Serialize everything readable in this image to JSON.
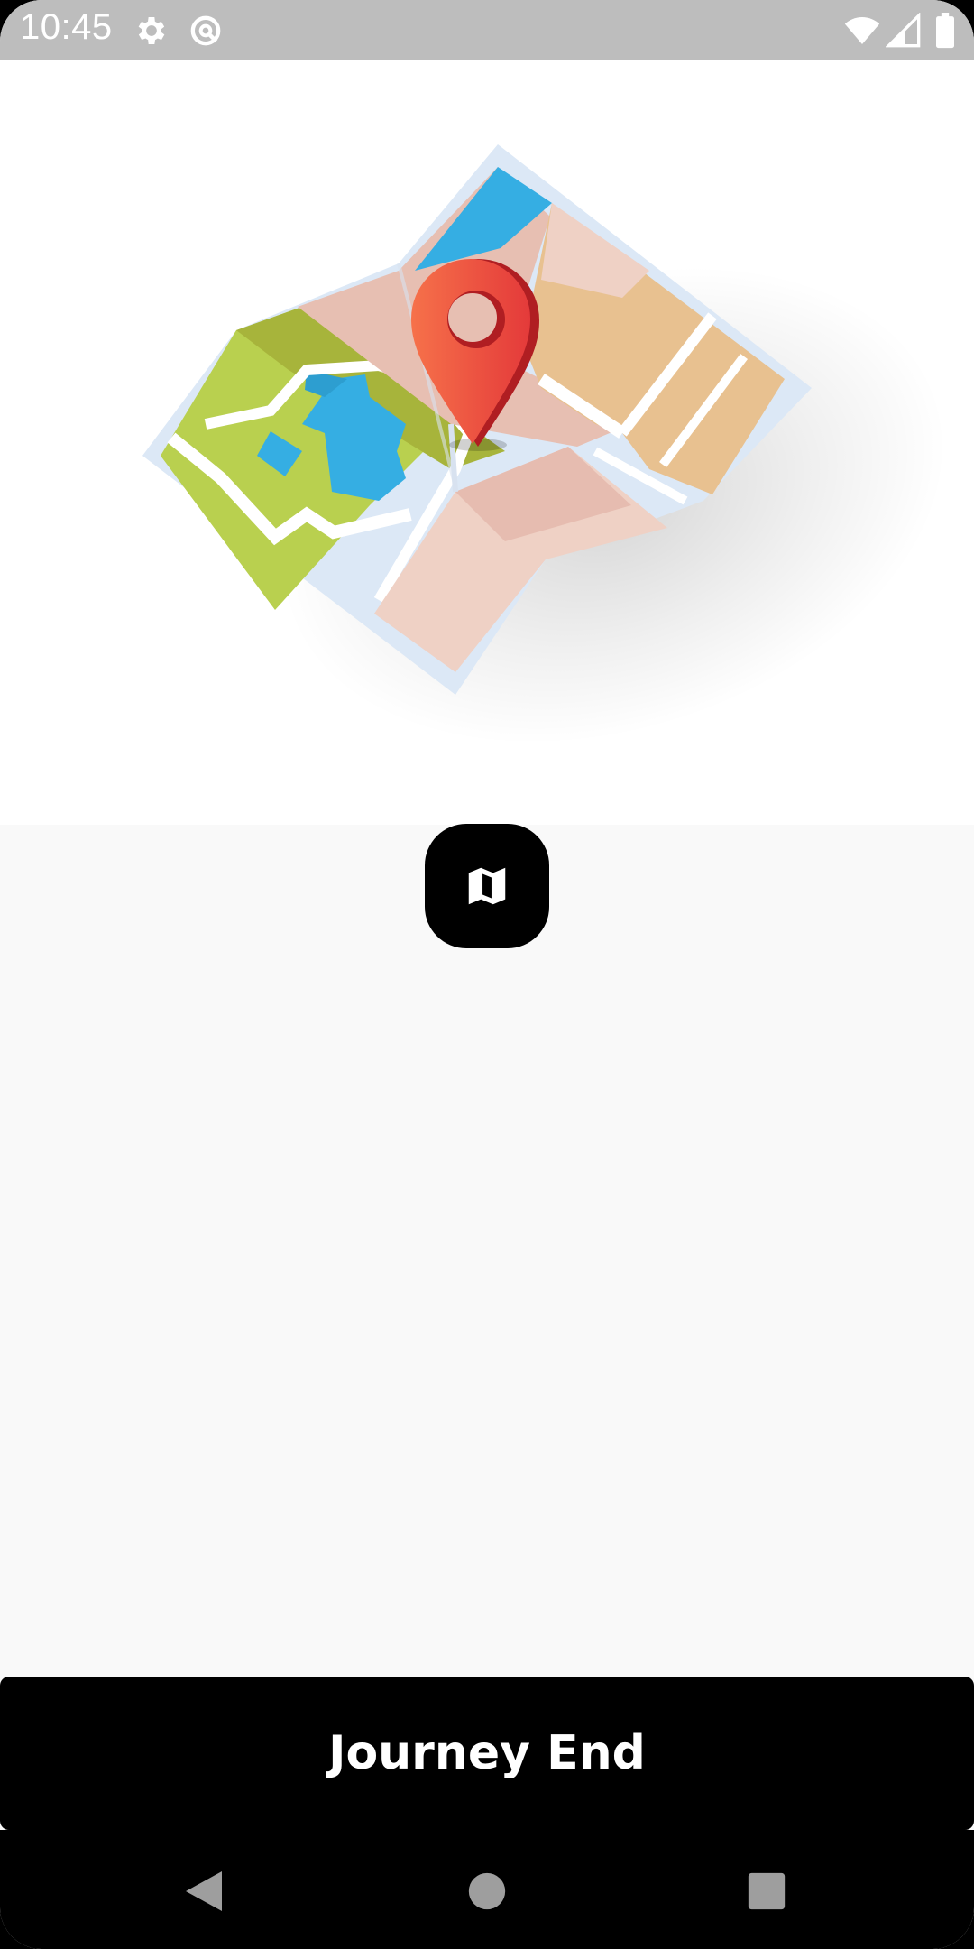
{
  "status_bar": {
    "time": "10:45",
    "icons": [
      "gear-icon",
      "data-saver-icon",
      "wifi-icon",
      "signal-icon",
      "battery-icon"
    ]
  },
  "hero": {
    "illustration": "folded-map-with-location-pin"
  },
  "map_button": {
    "icon": "map-icon"
  },
  "journey_button": {
    "label": "Journey End"
  },
  "nav_bar": {
    "icons": [
      "back-icon",
      "home-icon",
      "recents-icon"
    ]
  },
  "colors": {
    "status_bar": "#bdbdbd",
    "background": "#f9f9f9",
    "button": "#000000",
    "pin": "#e8403a",
    "map_green": "#b9d04f",
    "map_water": "#35aee3",
    "map_peach": "#e8c190"
  }
}
